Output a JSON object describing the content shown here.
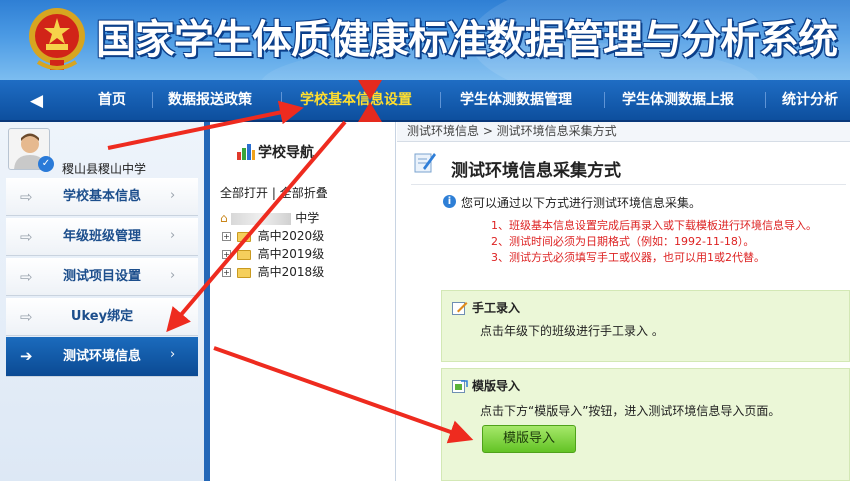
{
  "header": {
    "system_title": "国家学生体质健康标准数据管理与分析系统"
  },
  "nav": {
    "items": [
      {
        "label": "首页",
        "active": false
      },
      {
        "label": "数据报送政策",
        "active": false
      },
      {
        "label": "学校基本信息设置",
        "active": true
      },
      {
        "label": "学生体测数据管理",
        "active": false
      },
      {
        "label": "学生体测数据上报",
        "active": false
      },
      {
        "label": "统计分析",
        "active": false
      }
    ]
  },
  "sidebar": {
    "school_name": "稷山县稷山中学",
    "items": [
      {
        "label": "学校基本信息",
        "active": false
      },
      {
        "label": "年级班级管理",
        "active": false
      },
      {
        "label": "测试项目设置",
        "active": false
      },
      {
        "label": "Ukey绑定",
        "active": false
      },
      {
        "label": "测试环境信息",
        "active": true
      }
    ]
  },
  "tree": {
    "title": "学校导航",
    "expand_all": "全部打开",
    "collapse_all": "全部折叠",
    "root_label": "中学",
    "nodes": [
      "高中2020级",
      "高中2019级",
      "高中2018级"
    ]
  },
  "main": {
    "breadcrumb": "测试环境信息 > 测试环境信息采集方式",
    "page_title": "测试环境信息采集方式",
    "info_text": "您可以通过以下方式进行测试环境信息采集。",
    "notes": [
      "1、班级基本信息设置完成后再录入或下载模板进行环境信息导入。",
      "2、测试时间必须为日期格式（例如：1992-11-18）。",
      "3、测试方式必须填写手工或仪器，也可以用1或2代替。"
    ],
    "manual": {
      "title": "手工录入",
      "text": "点击年级下的班级进行手工录入 。"
    },
    "template": {
      "title": "模版导入",
      "text": "点击下方“模版导入”按钮，进入测试环境信息导入页面。",
      "button_label": "模版导入"
    }
  },
  "colors": {
    "banner": "#3b8ad9",
    "nav_bg": "#0d4f9e",
    "nav_active": "#ffde2f",
    "sidebar_active": "#0b4a93",
    "note_red": "#dd2222",
    "box_green": "#ebf7d7",
    "button_green": "#63c325",
    "arrow_red": "#ee2b1f"
  }
}
